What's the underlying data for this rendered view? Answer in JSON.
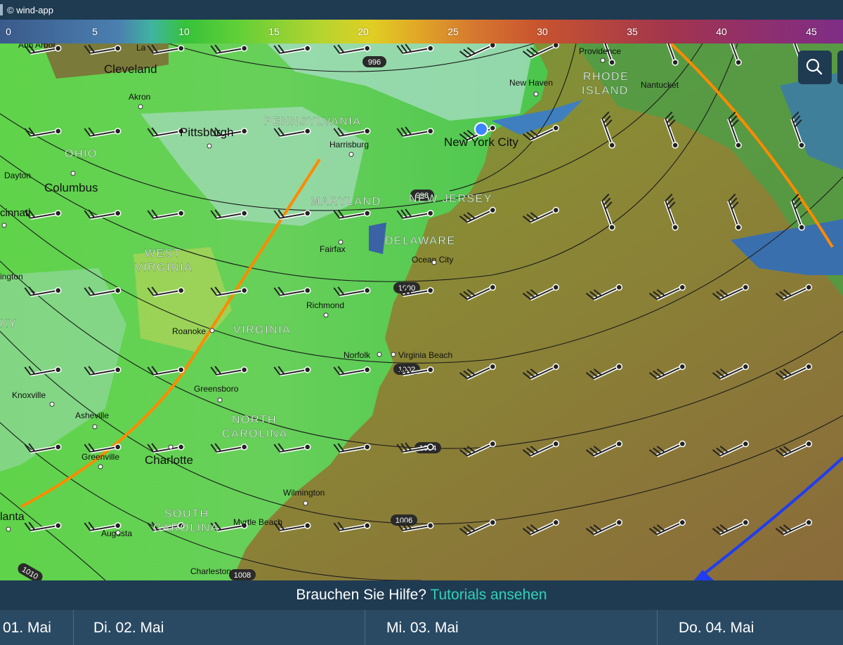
{
  "app": {
    "title": "© wind-app"
  },
  "legend": {
    "ticks": [
      "0",
      "5",
      "10",
      "15",
      "20",
      "25",
      "30",
      "35",
      "40",
      "45"
    ]
  },
  "map": {
    "isobars": [
      "996",
      "998",
      "1000",
      "1002",
      "1004",
      "1006",
      "1008",
      "1010"
    ],
    "states": [
      "PENNSYLVANIA",
      "OHIO",
      "MARYLAND",
      "NEW JERSEY",
      "DELAWARE",
      "WEST",
      "VIRGINIA",
      "VIRGINIA",
      "NORTH",
      "CAROLINA",
      "SOUTH",
      "CAROLINA",
      "RHODE",
      "ISLAND",
      "KY"
    ],
    "cities": [
      "Ann Arbor",
      "Cleveland",
      "Akron",
      "Pittsburgh",
      "Dayton",
      "Columbus",
      "cinnati",
      "ington",
      "Harrisburg",
      "Fairfax",
      "Richmond",
      "Roanoke",
      "Norfolk",
      "Virginia Beach",
      "Greensboro",
      "Knoxville",
      "Asheville",
      "Greenville",
      "Charlotte",
      "Wilmington",
      "Myrtle Beach",
      "Augusta",
      "lanta",
      "Charleston",
      "New York City",
      "New Haven",
      "Providence",
      "Nantucket",
      "Ocean City",
      "La"
    ]
  },
  "help": {
    "question": "Brauchen Sie Hilfe?",
    "link": "Tutorials ansehen"
  },
  "days": [
    "01. Mai",
    "Di. 02. Mai",
    "Mi. 03. Mai",
    "Do. 04. Mai"
  ]
}
